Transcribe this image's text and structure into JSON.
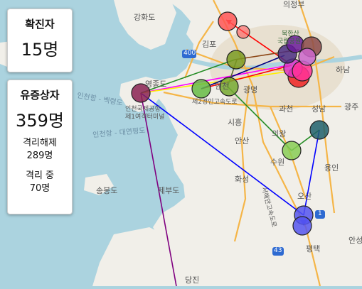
{
  "stats": {
    "confirmed_label": "확진자",
    "confirmed_value": "15명",
    "symptom_label": "유증상자",
    "symptom_value": "359명",
    "released_label": "격리해제",
    "released_value": "289명",
    "isolating_label": "격리 중",
    "isolating_value": "70명"
  },
  "map_labels": {
    "uijeongbu": "의정부",
    "ganghwa": "강화도",
    "gimpo": "김포",
    "bukhansan": "북한산",
    "national_park": "국립공원",
    "hanam": "하남",
    "yeongjong": "영종도",
    "incheon": "인천",
    "gwangmyeong": "광명",
    "incheon_airport": "인천국제공항",
    "terminal": "제1여객터미널",
    "gwacheon": "과천",
    "seongnam": "성남",
    "gwangju": "광주",
    "siheung": "시흥",
    "uiwang": "의왕",
    "ansan": "안산",
    "suwon": "수원",
    "yongin": "용인",
    "hwaseong": "화성",
    "seonggam": "송봉도",
    "jebu": "제부도",
    "osan": "오산",
    "pyeongtaek": "평택",
    "dangjin": "당진",
    "anseong": "안성",
    "sea_route_1": "인천항 - 백령도",
    "sea_route_2": "인천항 - 대연평도",
    "highway_400": "400",
    "highway_1": "1",
    "highway_43": "43",
    "seohae_bridge": "서해안고속도로",
    "second_gyeongin": "제2경인고속도로"
  },
  "colors": {
    "land": "#f1efe9",
    "sea": "#abd3df",
    "road": "#f5b547",
    "line_blue": "#0000ff",
    "line_red": "#ff0000",
    "line_green": "#228b22",
    "line_purple": "#800080",
    "line_yellow": "#ffee00",
    "line_magenta": "#ff00ff",
    "line_brown": "#8b4513",
    "line_navy": "#000080"
  },
  "markers": [
    {
      "name": "marker-incheon-airport",
      "color": "#8b2252"
    },
    {
      "name": "marker-incheon-1",
      "color": "#66bb44"
    },
    {
      "name": "marker-incheon-2",
      "color": "#66bb44"
    },
    {
      "name": "marker-gimpo-olive",
      "color": "#7a9a22"
    },
    {
      "name": "marker-seoul-purple",
      "color": "#4b2e83"
    },
    {
      "name": "marker-seoul-brown",
      "color": "#8b4a4a"
    },
    {
      "name": "marker-seoul-red",
      "color": "#ee2222"
    },
    {
      "name": "marker-seoul-magenta",
      "color": "#dd33cc"
    },
    {
      "name": "marker-seoul-pink",
      "color": "#ff3399"
    },
    {
      "name": "marker-goyang-red",
      "color": "#ff5555"
    },
    {
      "name": "marker-suwon-green",
      "color": "#88cc55"
    },
    {
      "name": "marker-seongnam-teal",
      "color": "#1f5f6b"
    },
    {
      "name": "marker-pyeongtaek-blue-1",
      "color": "#5555ee"
    },
    {
      "name": "marker-pyeongtaek-blue-2",
      "color": "#5555ee"
    }
  ]
}
